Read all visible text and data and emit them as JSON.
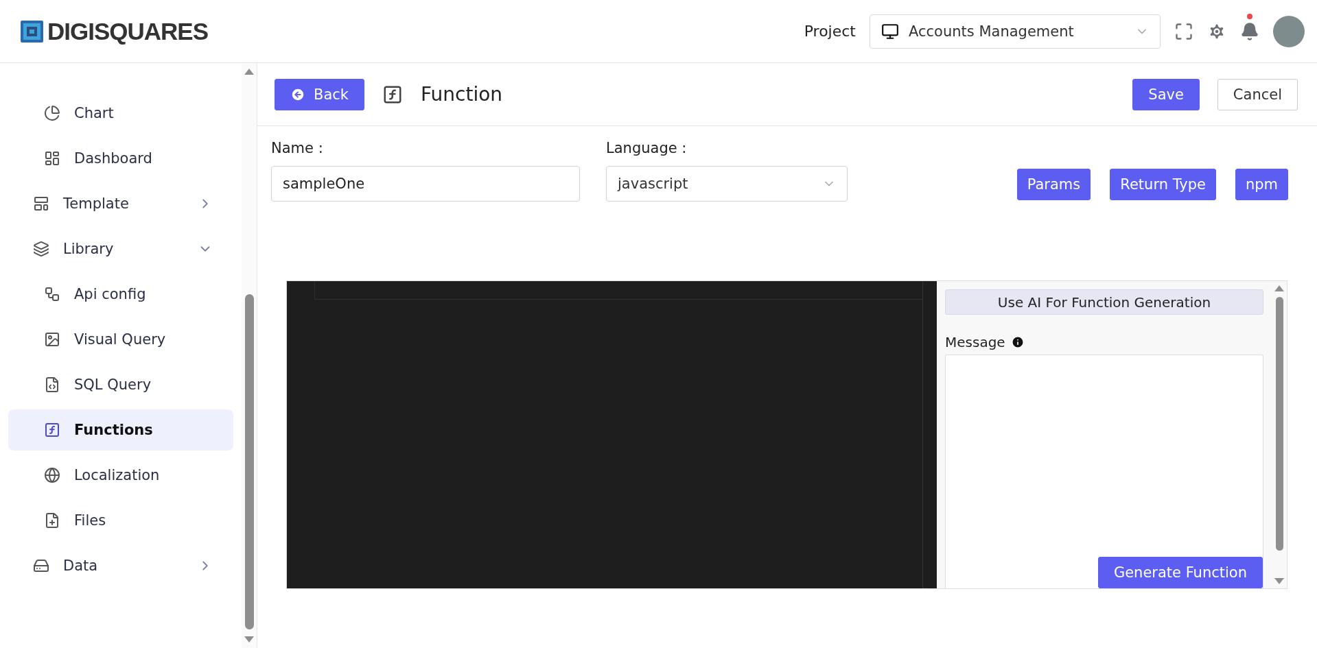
{
  "header": {
    "logo": "DIGISQUARES",
    "project_label": "Project",
    "project": "Accounts Management"
  },
  "sidebar": {
    "items": [
      {
        "kind": "page",
        "label": "Chart",
        "selected": false
      },
      {
        "kind": "page",
        "label": "Dashboard",
        "selected": false
      },
      {
        "kind": "group",
        "label": "Template",
        "expanded": false
      },
      {
        "kind": "group",
        "label": "Library",
        "expanded": true,
        "children": [
          {
            "kind": "page",
            "label": "Api config",
            "selected": false
          },
          {
            "kind": "page",
            "label": "Visual Query",
            "selected": false
          },
          {
            "kind": "page",
            "label": "SQL Query",
            "selected": false
          },
          {
            "kind": "page",
            "label": "Functions",
            "selected": true
          },
          {
            "kind": "page",
            "label": "Localization",
            "selected": false
          },
          {
            "kind": "page",
            "label": "Files",
            "selected": false
          }
        ]
      },
      {
        "kind": "group",
        "label": "Data",
        "expanded": false
      }
    ]
  },
  "toolbar": {
    "back": "Back",
    "title": "Function",
    "save": "Save",
    "cancel": "Cancel"
  },
  "form": {
    "name_label": "Name :",
    "name_value": "sampleOne",
    "language_label": "Language :",
    "language_value": "javascript",
    "buttons": [
      "Params",
      "Return Type",
      "npm"
    ]
  },
  "ai_panel": {
    "title": "Use AI For Function Generation",
    "message_label": "Message",
    "generate": "Generate Function"
  }
}
